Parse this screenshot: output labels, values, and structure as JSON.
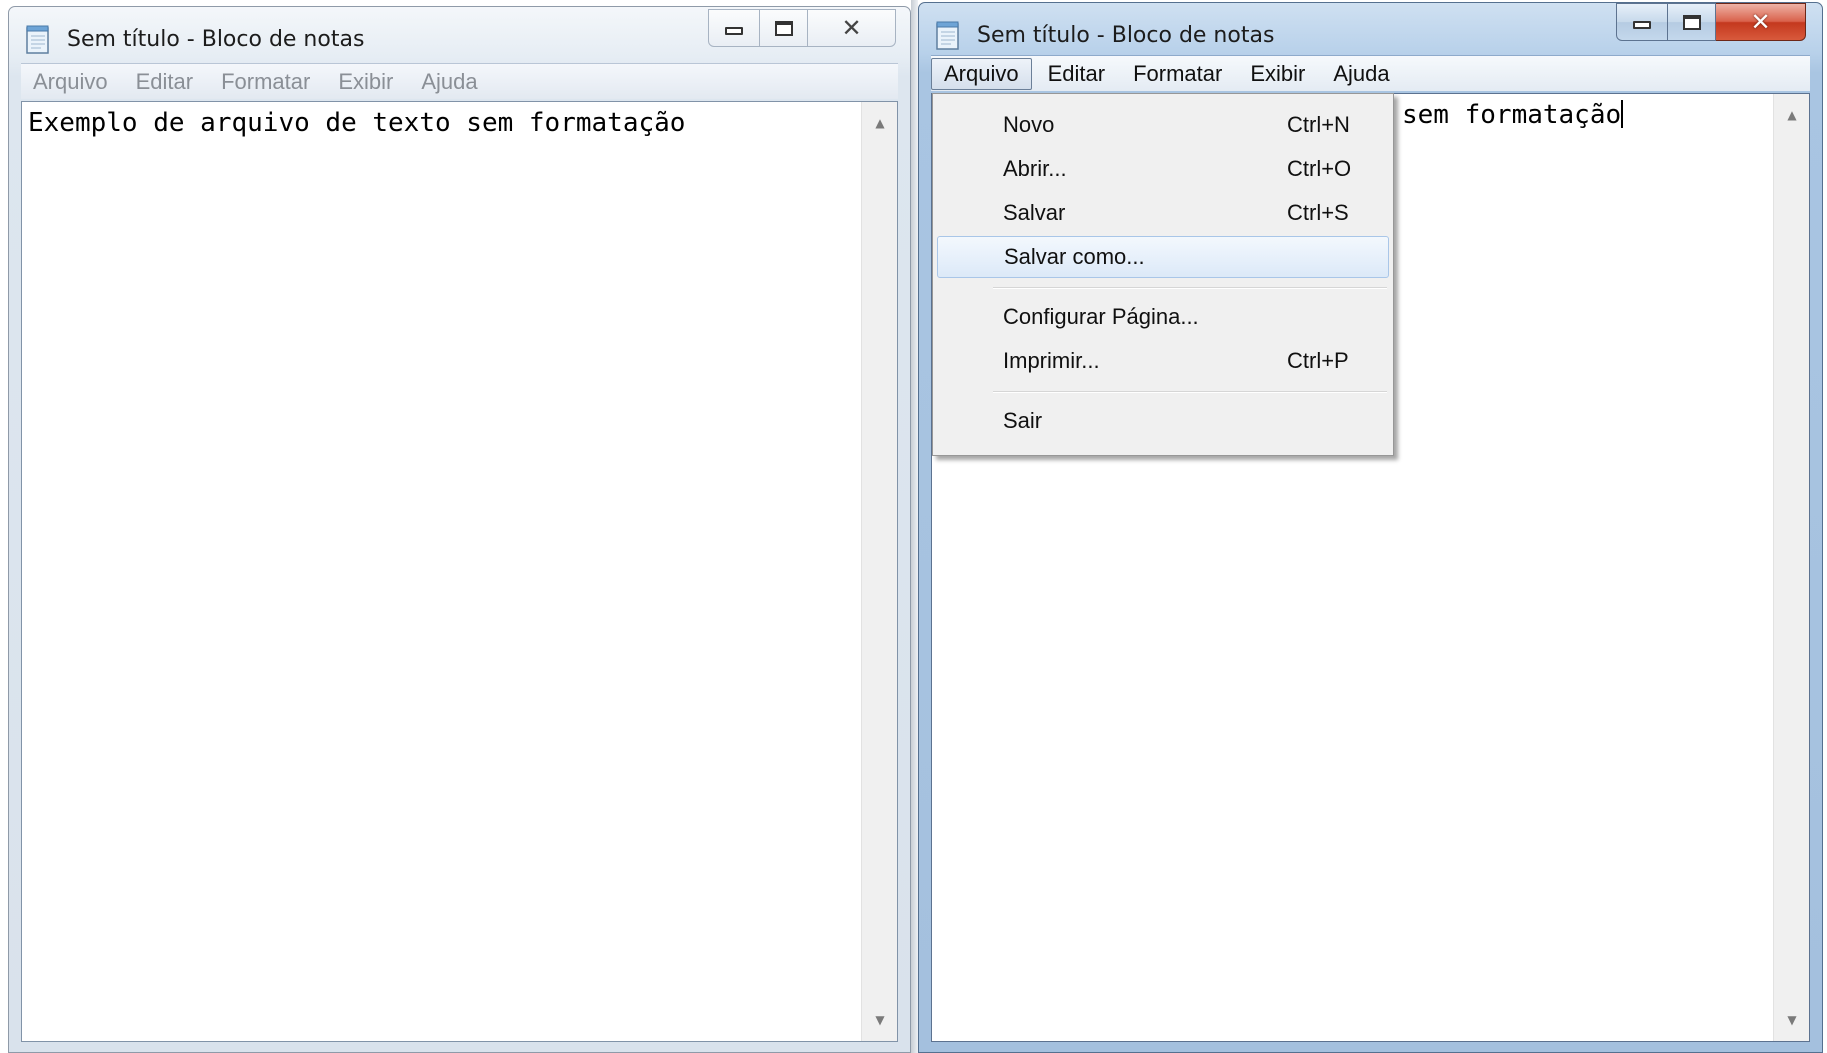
{
  "windows": [
    {
      "title": "Sem título - Bloco de notas",
      "state": "inactive",
      "menu": [
        "Arquivo",
        "Editar",
        "Formatar",
        "Exibir",
        "Ajuda"
      ],
      "content": "Exemplo de arquivo de texto sem formatação"
    },
    {
      "title": "Sem título - Bloco de notas",
      "state": "active",
      "menu": [
        "Arquivo",
        "Editar",
        "Formatar",
        "Exibir",
        "Ajuda"
      ],
      "content_visible": "sem formatação",
      "open_menu": "Arquivo"
    }
  ],
  "file_menu": {
    "items": [
      {
        "label": "Novo",
        "shortcut": "Ctrl+N"
      },
      {
        "label": "Abrir...",
        "shortcut": "Ctrl+O"
      },
      {
        "label": "Salvar",
        "shortcut": "Ctrl+S"
      },
      {
        "label": "Salvar como...",
        "shortcut": "",
        "highlighted": true
      },
      {
        "label": "Configurar Página...",
        "shortcut": ""
      },
      {
        "label": "Imprimir...",
        "shortcut": "Ctrl+P"
      },
      {
        "label": "Sair",
        "shortcut": ""
      }
    ]
  },
  "icons": {
    "app": "notepad-icon",
    "minimize": "minimize-icon",
    "maximize": "maximize-icon",
    "close": "close-icon",
    "scroll_up": "scroll-up-arrow-icon",
    "scroll_down": "scroll-down-arrow-icon"
  },
  "colors": {
    "active_frame": "#a9c5e2",
    "inactive_frame": "#dde6ef",
    "close_button": "#c4381e",
    "menu_highlight": "#dce9f8"
  }
}
